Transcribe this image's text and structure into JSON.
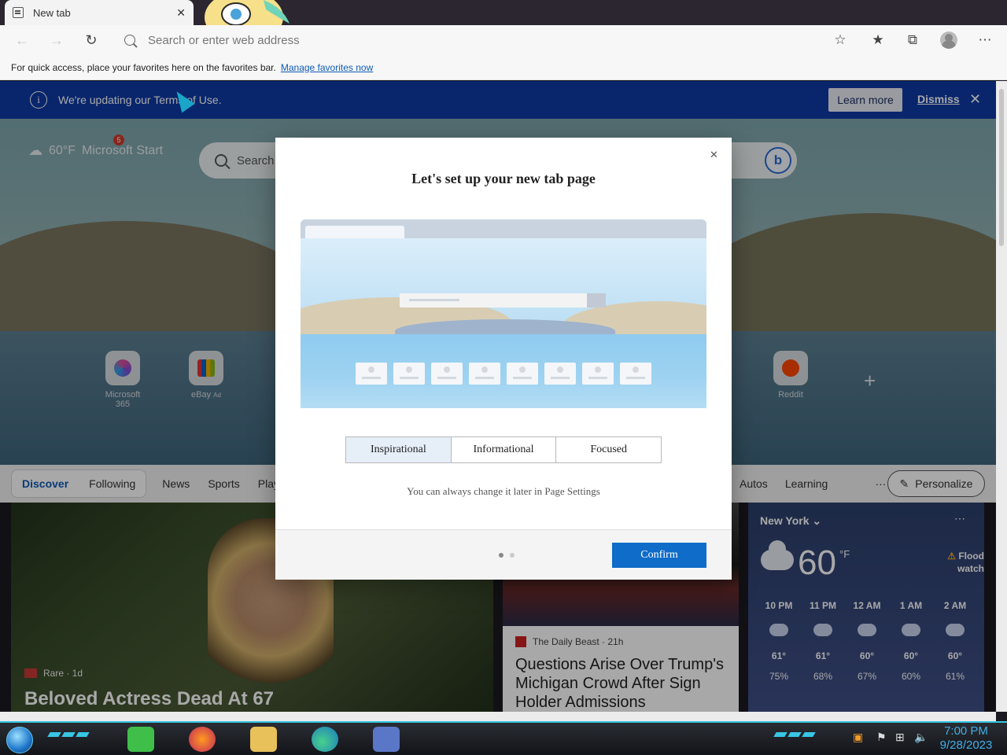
{
  "browser": {
    "tab_title": "New tab",
    "address_placeholder": "Search or enter web address",
    "favorites_bar_text": "For quick access, place your favorites here on the favorites bar.",
    "favorites_link": "Manage favorites now"
  },
  "notice": {
    "text": "We're updating our Terms of Use.",
    "learn_more": "Learn more",
    "dismiss": "Dismiss"
  },
  "newtab": {
    "weather_temp": "60°F",
    "brand": "Microsoft Start",
    "notification_count": "5",
    "search_placeholder": "Search the web",
    "quick_links": [
      {
        "label": "Microsoft 365",
        "ad": ""
      },
      {
        "label": "eBay",
        "ad": "Ad"
      },
      {
        "label": "Reddit",
        "ad": ""
      }
    ],
    "feed_tabs": {
      "discover": "Discover",
      "following": "Following",
      "news": "News",
      "sports": "Sports",
      "play": "Play",
      "autos": "Autos",
      "learning": "Learning",
      "more": "···",
      "personalize": "Personalize"
    },
    "cards": {
      "left_source": "Rare · 1d",
      "left_headline": "Beloved Actress Dead At 67",
      "mid_source": "The Daily Beast · 21h",
      "mid_headline": "Questions Arise Over Trump's Michigan Crowd After Sign Holder Admissions"
    },
    "weather": {
      "city": "New York",
      "temp": "60",
      "unit": "°F",
      "alert": "Flood watch",
      "hours": [
        {
          "time": "10 PM",
          "temp": "61°",
          "precip": "75%"
        },
        {
          "time": "11 PM",
          "temp": "61°",
          "precip": "68%"
        },
        {
          "time": "12 AM",
          "temp": "60°",
          "precip": "67%"
        },
        {
          "time": "1 AM",
          "temp": "60°",
          "precip": "60%"
        },
        {
          "time": "2 AM",
          "temp": "60°",
          "precip": "61%"
        }
      ]
    }
  },
  "dialog": {
    "title": "Let's set up your new tab page",
    "options": [
      "Inspirational",
      "Informational",
      "Focused"
    ],
    "selected": "Inspirational",
    "hint": "You can always change it later in Page Settings",
    "confirm": "Confirm",
    "page_indicator": {
      "current": 1,
      "total": 2
    }
  },
  "taskbar": {
    "time": "7:00 PM",
    "date": "9/28/2023"
  },
  "colors": {
    "notice_bg": "#0f3aa5",
    "confirm_bg": "#0f6cc8",
    "link": "#0f5bb5"
  }
}
